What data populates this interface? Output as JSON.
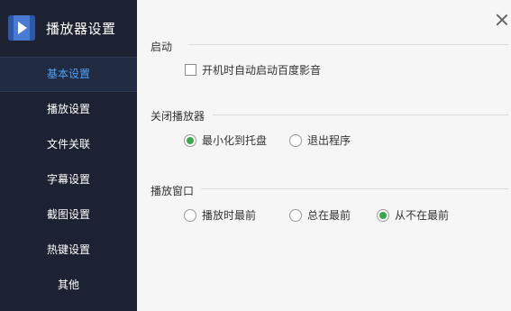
{
  "app": {
    "title": "播放器设置"
  },
  "sidebar": {
    "items": [
      {
        "label": "基本设置",
        "active": true
      },
      {
        "label": "播放设置"
      },
      {
        "label": "文件关联"
      },
      {
        "label": "字幕设置"
      },
      {
        "label": "截图设置"
      },
      {
        "label": "热键设置"
      },
      {
        "label": "其他"
      }
    ]
  },
  "sections": {
    "startup": {
      "title": "启动",
      "options": [
        {
          "label": "开机时自动启动百度影音",
          "checked": false
        }
      ]
    },
    "close_player": {
      "title": "关闭播放器",
      "options": [
        {
          "label": "最小化到托盘",
          "selected": true
        },
        {
          "label": "退出程序",
          "selected": false
        }
      ]
    },
    "play_window": {
      "title": "播放窗口",
      "options": [
        {
          "label": "播放时最前",
          "selected": false
        },
        {
          "label": "总在最前",
          "selected": false
        },
        {
          "label": "从不在最前",
          "selected": true
        }
      ]
    }
  },
  "colors": {
    "sidebar_bg": "#1c2231",
    "active_text": "#4fa0f5",
    "radio_selected": "#3aa84a"
  }
}
